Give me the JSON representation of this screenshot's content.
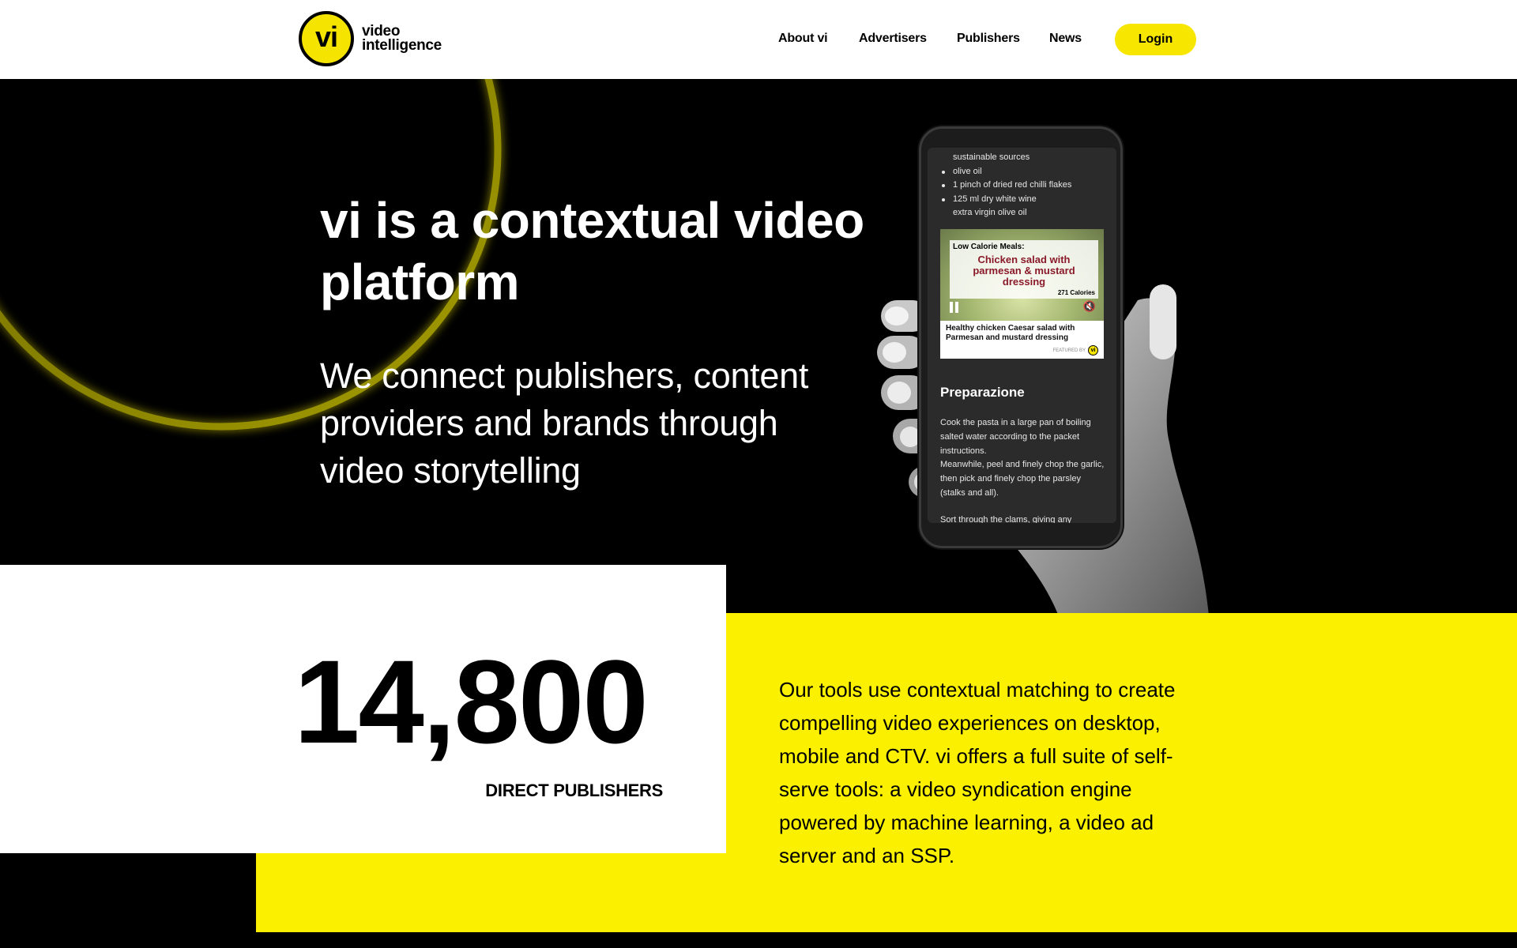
{
  "brand": {
    "mark": "vi",
    "line1": "video",
    "line2": "intelligence"
  },
  "nav": {
    "items": [
      {
        "label": "About vi"
      },
      {
        "label": "Advertisers"
      },
      {
        "label": "Publishers"
      },
      {
        "label": "News"
      }
    ],
    "login": "Login"
  },
  "hero": {
    "title": "vi is a contextual video platform",
    "subtitle": "We connect publishers, content providers and brands through video storytelling"
  },
  "phone": {
    "ingredients": [
      {
        "text": "sustainable sources",
        "bullet": false
      },
      {
        "text": "olive oil",
        "bullet": true
      },
      {
        "text": "1 pinch of dried red chilli flakes",
        "bullet": true
      },
      {
        "text": "125 ml dry white wine",
        "bullet": true
      },
      {
        "text": "extra virgin olive oil",
        "bullet": false
      }
    ],
    "video": {
      "kicker": "Low Calorie Meals:",
      "headline": "Chicken salad with parmesan & mustard dressing",
      "calories": "271 Calories",
      "caption": "Healthy chicken Caesar salad with Parmesan and mustard dressing",
      "featured_by": "FEATURED BY"
    },
    "section_title": "Preparazione",
    "section_text": "Cook the pasta in a large pan of boiling salted water according to the packet instructions.",
    "section_text2": "Meanwhile, peel and finely chop the garlic, then pick and finely chop the parsley (stalks and all).",
    "section_text3": "Sort through the clams, giving any"
  },
  "stats": {
    "number": "14,800",
    "label": "DIRECT PUBLISHERS",
    "description": "Our tools use contextual matching to create compelling video experiences on desktop, mobile and CTV. vi offers a full suite of self-serve tools: a video syndication engine powered by machine learning, a video ad server and an SSP."
  },
  "colors": {
    "brand_yellow": "#fbf000",
    "black": "#000000",
    "white": "#ffffff"
  }
}
